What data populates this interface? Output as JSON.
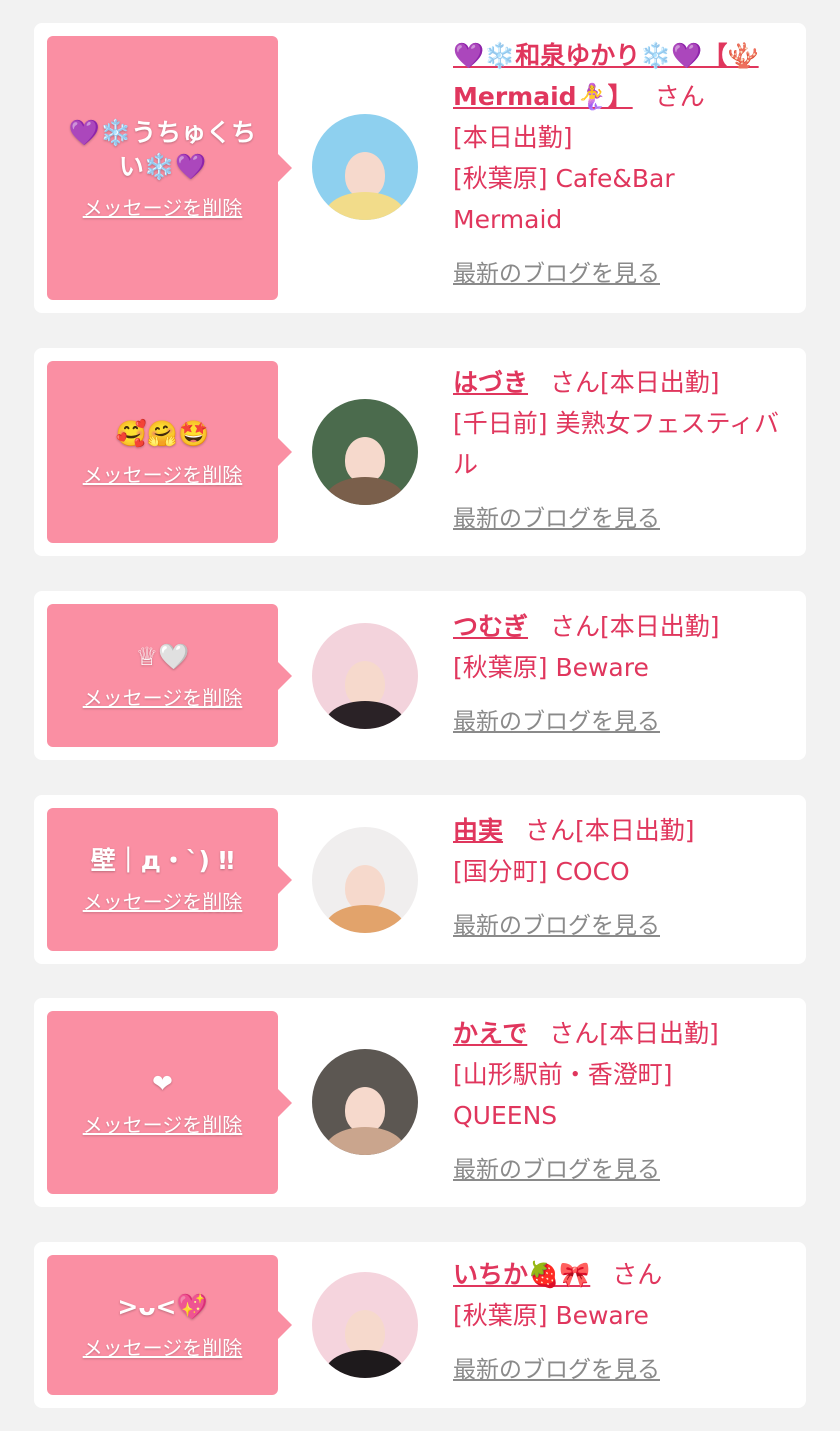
{
  "common": {
    "delete_label": "メッセージを削除",
    "blog_label": "最新のブログを見る",
    "honorific": "さん"
  },
  "cards": [
    {
      "bubble": "💜❄️うちゅくちい❄️💜",
      "name": "💜❄️和泉ゆかり❄️💜【🪸Mermaid🧜‍♀️】",
      "shift": "[本日出勤]",
      "store": "[秋葉原] Cafe&Bar Mermaid",
      "avatar_colors": [
        "#8ed0ef",
        "#f2dc8a"
      ]
    },
    {
      "bubble": "🥰🤗🤩",
      "name": "はづき",
      "shift": "[本日出勤]",
      "store": "[千日前] 美熟女フェスティバル",
      "avatar_colors": [
        "#4b6b4d",
        "#7a5f4b"
      ]
    },
    {
      "bubble": "♕🤍",
      "name": "つむぎ",
      "shift": "[本日出勤]",
      "store": "[秋葉原] Beware",
      "avatar_colors": [
        "#f3d3dc",
        "#2a2226"
      ]
    },
    {
      "bubble": "壁｜д・`) ‼",
      "name": "由実",
      "shift": "[本日出勤]",
      "store": "[国分町] COCO",
      "avatar_colors": [
        "#f0eeee",
        "#e2a36b"
      ]
    },
    {
      "bubble": "❤",
      "name": "かえで",
      "shift": "[本日出勤]",
      "store": "[山形駅前・香澄町] QUEENS",
      "avatar_colors": [
        "#5c5752",
        "#caa58d"
      ]
    },
    {
      "bubble": ">ᴗ<💖",
      "name": "いちか🍓🎀",
      "shift": "",
      "store": "[秋葉原] Beware",
      "avatar_colors": [
        "#f5d4dd",
        "#1e1a1c"
      ]
    }
  ]
}
